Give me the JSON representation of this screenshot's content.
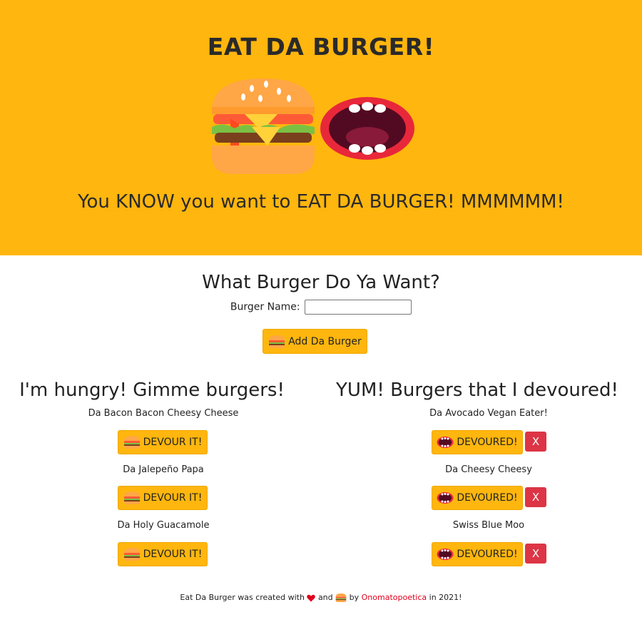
{
  "hero": {
    "title": "EAT DA BURGER!",
    "tagline": "You KNOW you want to EAT DA BURGER! MMMMMM!"
  },
  "form": {
    "heading": "What Burger Do Ya Want?",
    "label": "Burger Name:",
    "value": "",
    "add_button": "Add Da Burger"
  },
  "left": {
    "heading": "I'm hungry! Gimme burgers!",
    "button_label": "DEVOUR IT!",
    "burgers": [
      "Da Bacon Bacon Cheesy Cheese",
      "Da Jalepeño Papa",
      "Da Holy Guacamole"
    ]
  },
  "right": {
    "heading": "YUM! Burgers that I devoured!",
    "button_label": "DEVOURED!",
    "delete_label": "X",
    "burgers": [
      "Da Avocado Vegan Eater!",
      "Da Cheesy Cheesy",
      "Swiss Blue Moo"
    ]
  },
  "footer": {
    "pre": "Eat Da Burger was created with",
    "and": "and",
    "by": "by",
    "author": "Onomatopoetica",
    "post": "in 2021!"
  },
  "colors": {
    "brand": "#ffb60e",
    "danger": "#dc3545",
    "link": "#e0001b"
  },
  "icons": [
    "burger-icon",
    "mouth-icon",
    "heart-icon"
  ]
}
